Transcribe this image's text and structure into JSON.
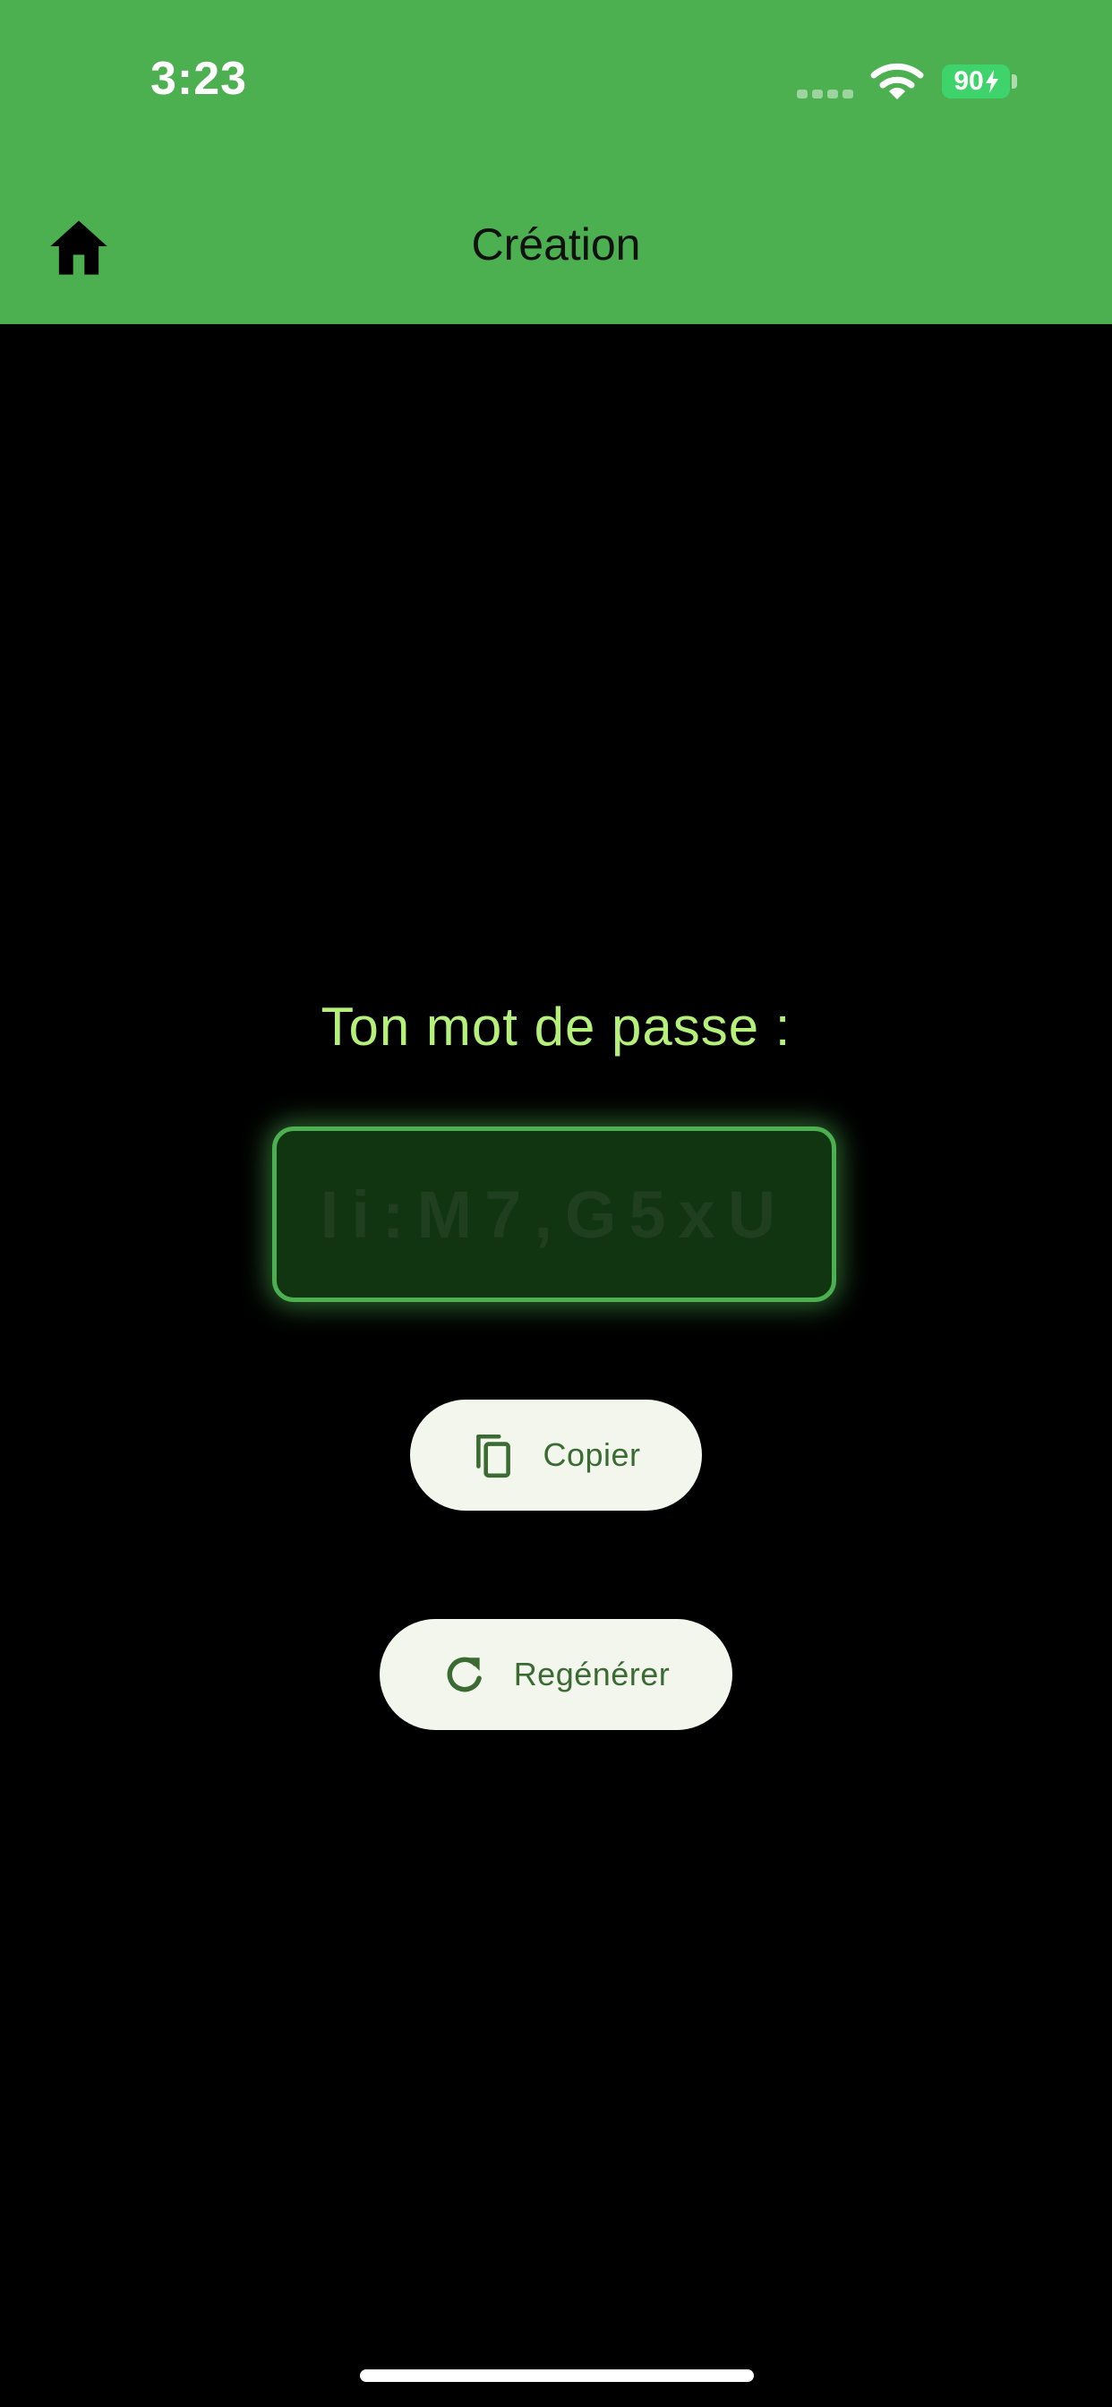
{
  "status_bar": {
    "time": "3:23",
    "battery_level": "90"
  },
  "header": {
    "title": "Création",
    "home_icon": "home-icon"
  },
  "main": {
    "prompt": "Ton mot de passe :",
    "password": "Ii:M7,G5xU",
    "copy_button": {
      "label": "Copier",
      "icon": "copy-icon"
    },
    "regenerate_button": {
      "label": "Regénérer",
      "icon": "refresh-icon"
    }
  },
  "colors": {
    "accent": "#4caf50",
    "prompt_text": "#b4f07a",
    "button_bg": "#f2f6ec",
    "button_text": "#3b6b33",
    "background": "#000000"
  }
}
